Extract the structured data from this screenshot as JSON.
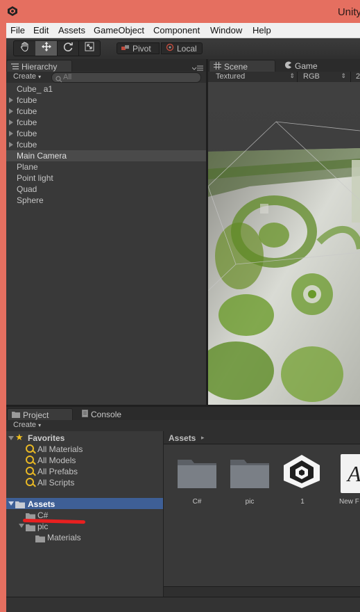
{
  "window": {
    "title": "Unity"
  },
  "menu": [
    "File",
    "Edit",
    "Assets",
    "GameObject",
    "Component",
    "Window",
    "Help"
  ],
  "toolbar": {
    "tools": [
      "hand-tool",
      "move-tool",
      "rotate-tool",
      "scale-tool"
    ],
    "pivot_label": "Pivot",
    "local_label": "Local"
  },
  "hierarchy": {
    "tab_label": "Hierarchy",
    "create_label": "Create",
    "search_placeholder": "All",
    "items": [
      {
        "label": "Cube_ a1",
        "expandable": false
      },
      {
        "label": "fcube",
        "expandable": true
      },
      {
        "label": "fcube",
        "expandable": true
      },
      {
        "label": "fcube",
        "expandable": true
      },
      {
        "label": "fcube",
        "expandable": true
      },
      {
        "label": "fcube",
        "expandable": true
      },
      {
        "label": "Main Camera",
        "expandable": false,
        "selected": true
      },
      {
        "label": "Plane",
        "expandable": false
      },
      {
        "label": "Point light",
        "expandable": false
      },
      {
        "label": "Quad",
        "expandable": false
      },
      {
        "label": "Sphere",
        "expandable": false
      }
    ]
  },
  "scene": {
    "tabs": [
      "Scene",
      "Game"
    ],
    "shading_mode": "Textured",
    "render_mode": "RGB",
    "extra": "2"
  },
  "project": {
    "tabs": [
      "Project",
      "Console"
    ],
    "create_label": "Create",
    "favorites_label": "Favorites",
    "favorites": [
      "All Materials",
      "All Models",
      "All Prefabs",
      "All Scripts"
    ],
    "assets_label": "Assets",
    "folders": [
      "C#",
      "pic",
      "Materials"
    ],
    "breadcrumb": "Assets",
    "grid": [
      {
        "label": "C#",
        "icon": "folder-icon"
      },
      {
        "label": "pic",
        "icon": "folder-icon"
      },
      {
        "label": "1",
        "icon": "unity-logo-icon"
      },
      {
        "label": "New F",
        "icon": "font-asset-icon",
        "glyph": "A"
      }
    ]
  },
  "colors": {
    "title_bar": "#e56f60",
    "selection": "#3e5f96",
    "annotation": "#e82020"
  }
}
